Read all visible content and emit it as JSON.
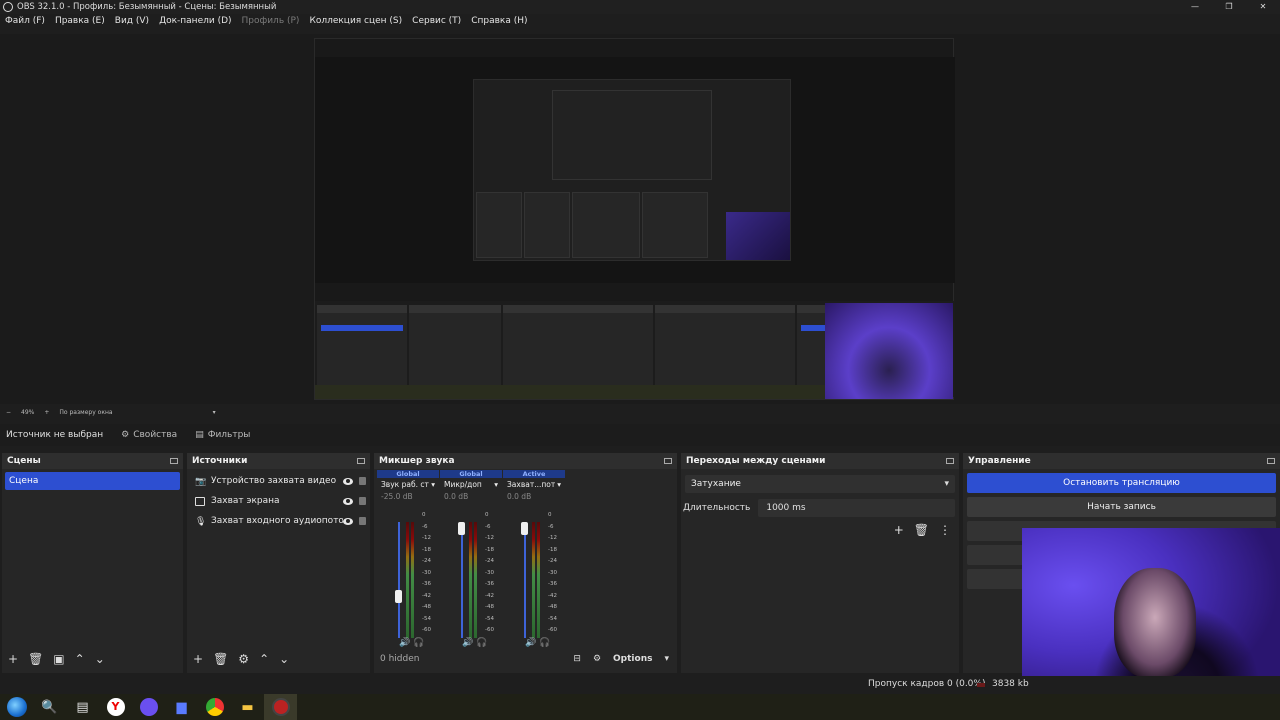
{
  "window": {
    "title": "OBS 32.1.0 - Профиль: Безымянный - Сцены: Безымянный"
  },
  "menu": [
    {
      "label": "Файл (F)",
      "enabled": true
    },
    {
      "label": "Правка (E)",
      "enabled": true
    },
    {
      "label": "Вид (V)",
      "enabled": true
    },
    {
      "label": "Док-панели (D)",
      "enabled": true
    },
    {
      "label": "Профиль (P)",
      "enabled": false
    },
    {
      "label": "Коллекция сцен (S)",
      "enabled": true
    },
    {
      "label": "Сервис (T)",
      "enabled": true
    },
    {
      "label": "Справка (H)",
      "enabled": true
    }
  ],
  "preview": {
    "zoom": "49%",
    "fit_mode": "По размеру окна"
  },
  "source_bar": {
    "status": "Источник не выбран",
    "properties": "Свойства",
    "filters": "Фильтры"
  },
  "scenes": {
    "title": "Сцены",
    "items": [
      "Сцена"
    ]
  },
  "sources": {
    "title": "Источники",
    "items": [
      {
        "label": "Устройство захвата видео",
        "icon": "camera-icon"
      },
      {
        "label": "Захват экрана",
        "icon": "monitor-icon"
      },
      {
        "label": "Захват входного аудиопотока",
        "icon": "microphone-icon"
      }
    ]
  },
  "mixer": {
    "title": "Микшер звука",
    "channels": [
      {
        "tag": "Global",
        "name": "Звук раб. стола",
        "db": "-25.0 dB",
        "level": 0.38
      },
      {
        "tag": "Global",
        "name": "Микр/доп",
        "db": "0.0 dB",
        "level": 1.0
      },
      {
        "tag": "Active",
        "name": "Захват...потока",
        "db": "0.0 dB",
        "level": 1.0
      }
    ],
    "scale": [
      "0",
      "-6",
      "-12",
      "-18",
      "-24",
      "-30",
      "-36",
      "-42",
      "-48",
      "-54",
      "-60"
    ],
    "hidden": "0 hidden",
    "options": "Options"
  },
  "transitions": {
    "title": "Переходы между сценами",
    "selected": "Затухание",
    "duration_label": "Длительность",
    "duration_value": "1000 ms"
  },
  "controls": {
    "title": "Управление",
    "stop_stream": "Остановить трансляцию",
    "start_record": "Начать запись"
  },
  "status": {
    "dropped_frames": "Пропуск кадров 0 (0.0%)",
    "bitrate": "3838 kb"
  },
  "colors": {
    "accent": "#2d4fd1",
    "panel": "#262626",
    "bg": "#1e1e1e"
  }
}
